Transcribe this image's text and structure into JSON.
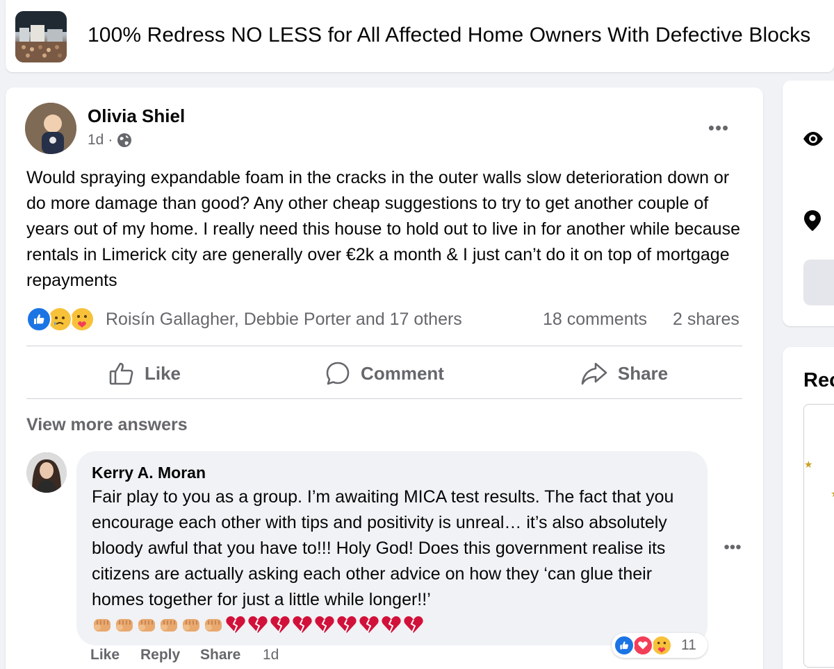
{
  "group": {
    "title": "100% Redress NO LESS for All Affected Home Owners With Defective Blocks"
  },
  "post": {
    "author": "Olivia Shiel",
    "time": "1d",
    "separator": "·",
    "more_label": "•••",
    "text": "Would spraying expandable foam in the cracks in the outer walls slow deterioration down or do more damage than good? Any other cheap suggestions to try to get another couple of years out of my home. I really need this house to hold out to live in for another while because rentals in Limerick city are generally over €2k a month & I just can’t do it on top of mortgage repayments",
    "reactors": "Roisín Gallagher, Debbie Porter and 17 others",
    "comments_count": "18 comments",
    "shares_count": "2 shares",
    "reactions": [
      "like-icon",
      "sad-icon",
      "care-icon"
    ]
  },
  "actions": {
    "like": "Like",
    "comment": "Comment",
    "share": "Share"
  },
  "view_more": "View more answers",
  "comment": {
    "author": "Kerry A. Moran",
    "text": "Fair play to you as a group. I’m awaiting MICA test results. The fact that you encourage each other with tips and positivity is unreal… it’s also absolutely bloody awful that you have to!!! Holy God! Does this government realise its citizens are actually asking each other advice on how they ‘can glue their homes together for just a little while longer!!’",
    "emojis": {
      "fists": 6,
      "broken_hearts": 9
    },
    "reaction_count": "11",
    "more_label": "•••",
    "actions": {
      "like": "Like",
      "reply": "Reply",
      "share": "Share",
      "time": "1d"
    }
  },
  "sidebar": {
    "heading": "Rec"
  },
  "colors": {
    "background": "#f0f2f5",
    "secondary_text": "#65676b",
    "like_blue": "#1b74e4",
    "love_red": "#f33e58",
    "care_yellow": "#f7c23a",
    "broken_heart": "#d2113a",
    "fist": "#e8a86e"
  }
}
